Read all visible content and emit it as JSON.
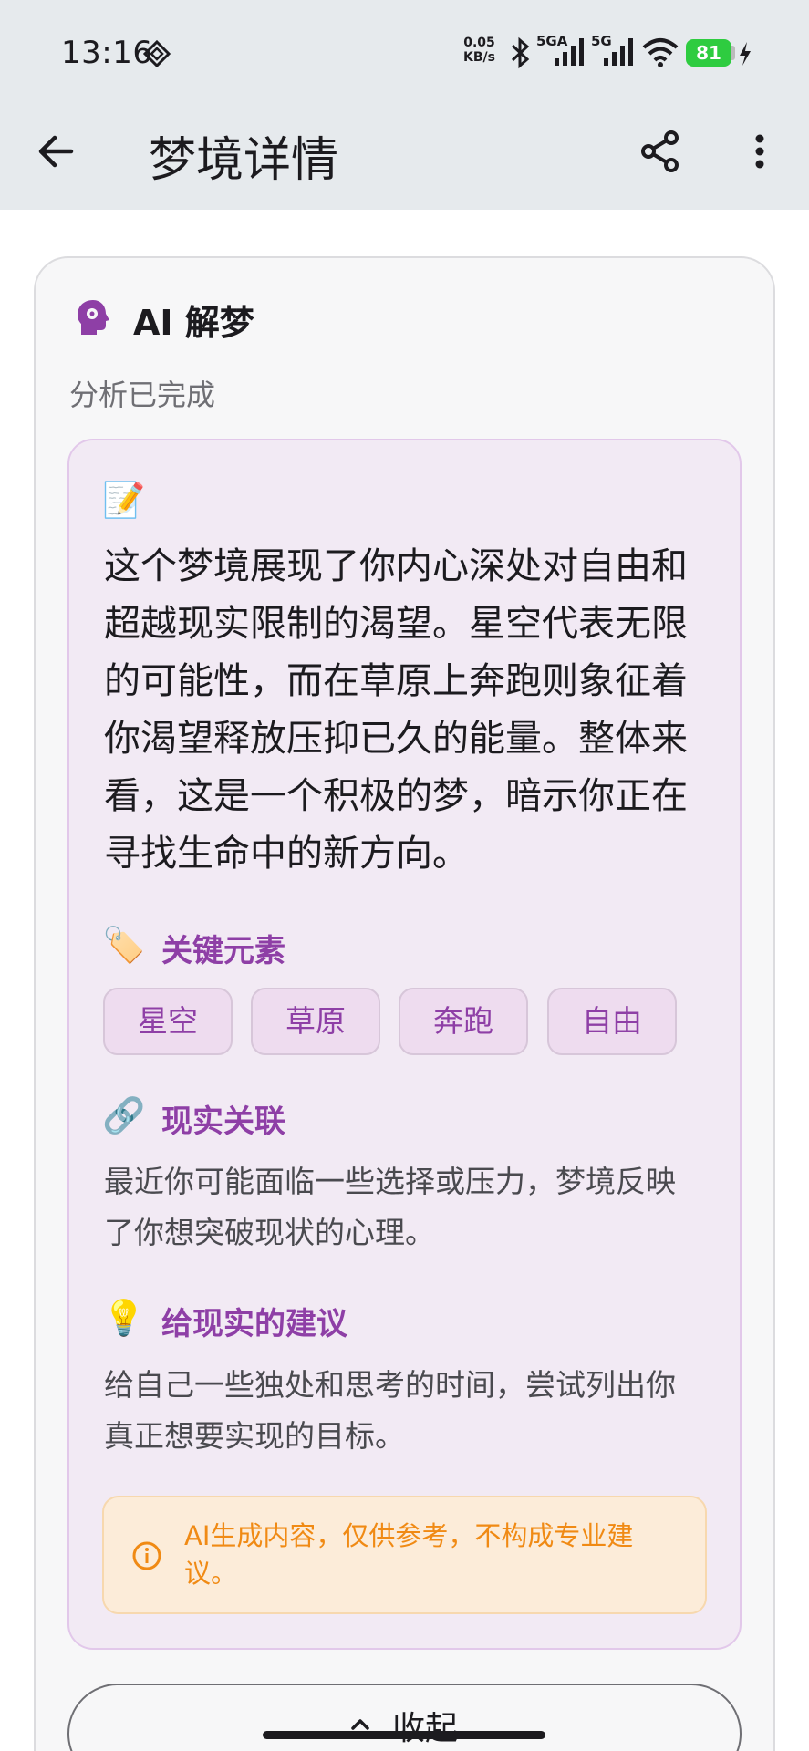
{
  "status_bar": {
    "time": "13:16",
    "net_speed_value": "0.05",
    "net_speed_unit": "KB/s",
    "signal1_label": "5GA",
    "signal2_label": "5G",
    "battery": "81"
  },
  "app_bar": {
    "title": "梦境详情"
  },
  "card": {
    "title": "AI 解梦",
    "subtitle": "分析已完成",
    "emoji_main": "📝",
    "interpretation": "这个梦境展现了你内心深处对自由和超越现实限制的渴望。星空代表无限的可能性，而在草原上奔跑则象征着你渴望释放压抑已久的能量。整体来看，这是一个积极的梦，暗示你正在寻找生命中的新方向。",
    "key_elements": {
      "emoji": "🏷️",
      "title": "关键元素",
      "chips": [
        "星空",
        "草原",
        "奔跑",
        "自由"
      ]
    },
    "reality_link": {
      "emoji": "🔗",
      "title": "现实关联",
      "text": "最近你可能面临一些选择或压力，梦境反映了你想突破现状的心理。"
    },
    "advice": {
      "emoji": "💡",
      "title": "给现实的建议",
      "text": "给自己一些独处和思考的时间，尝试列出你真正想要实现的目标。"
    },
    "notice": "AI生成内容，仅供参考，不构成专业建议。",
    "collapse_label": "收起"
  },
  "colors": {
    "accent": "#8e3fa6",
    "notice": "#f08a14",
    "battery": "#2ecc40"
  }
}
